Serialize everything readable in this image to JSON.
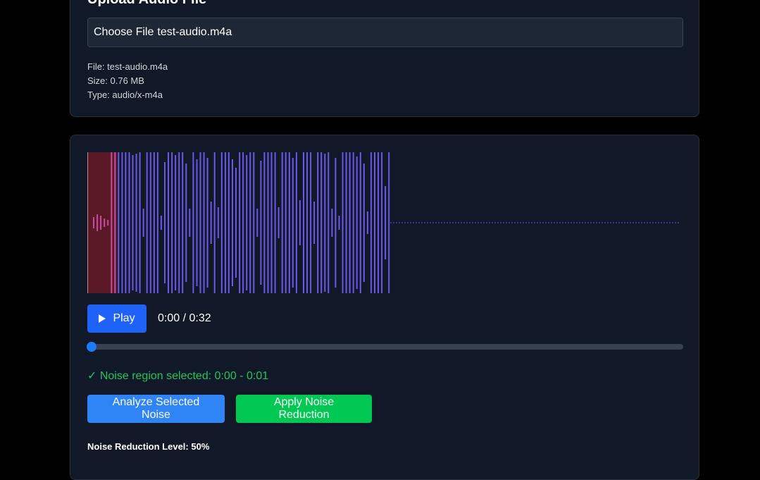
{
  "upload": {
    "title": "Upload Audio File",
    "choose_label": "Choose File",
    "file_name": "test-audio.m4a",
    "info": {
      "file": "File: test-audio.m4a",
      "size": "Size: 0.76 MB",
      "type": "Type: audio/x-m4a"
    }
  },
  "waveform": {
    "wave_color": "#6b57e8",
    "progress_color": "#c74aa0",
    "region_color": "#5b1826",
    "selected_region": {
      "start_s": 0,
      "end_s": 1
    },
    "duration_s": 32
  },
  "player": {
    "play_label": "Play",
    "time": "0:00 / 0:32",
    "progress": 0
  },
  "status": {
    "noise_region": "✓ Noise region selected: 0:00 - 0:01"
  },
  "actions": {
    "analyze_label": "Analyze Selected Noise",
    "apply_label": "Apply Noise Reduction"
  },
  "noise_reduction": {
    "label": "Noise Reduction Level: 50%"
  }
}
